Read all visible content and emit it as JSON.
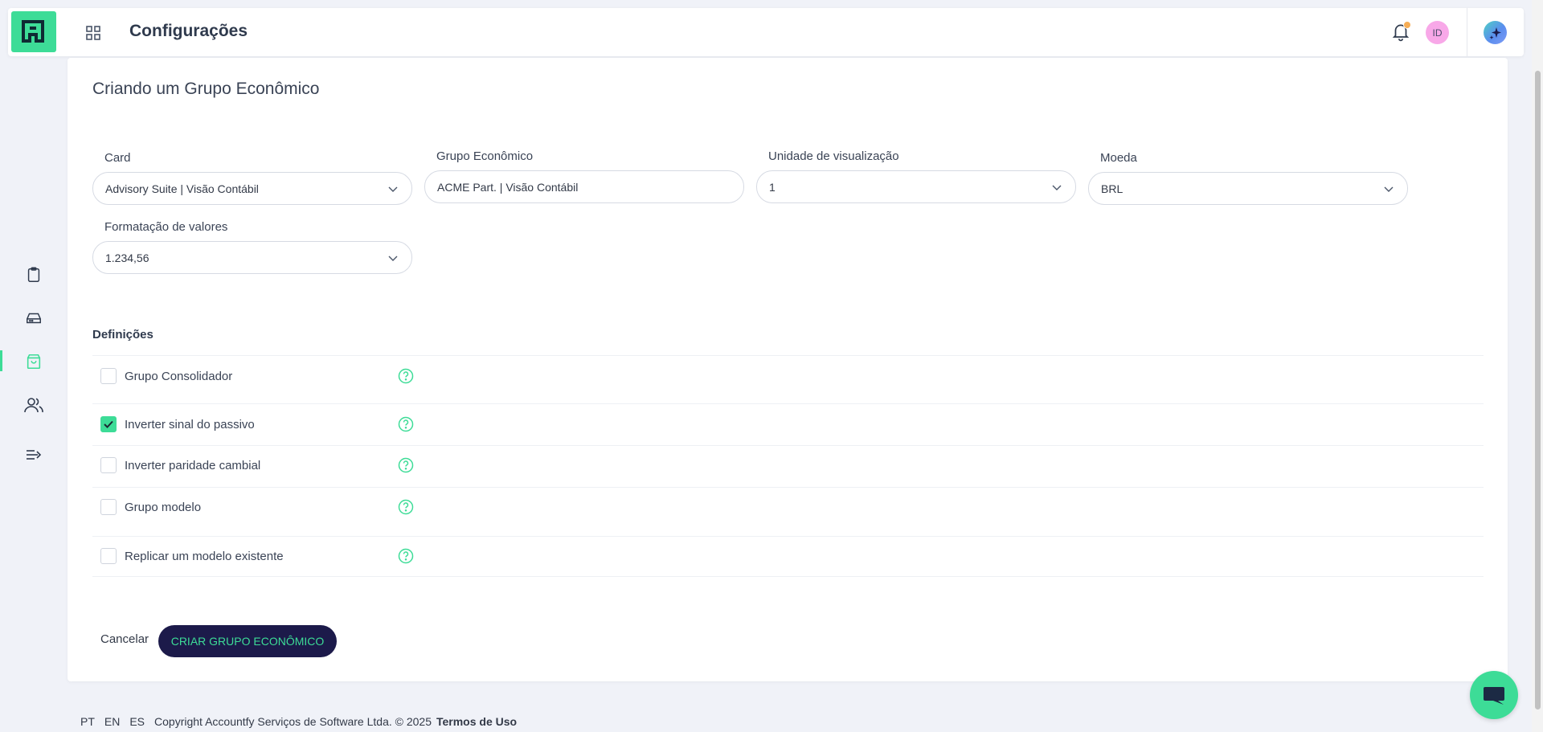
{
  "header": {
    "title": "Configurações",
    "avatar_initials": "ID",
    "icons": [
      "logo-icon",
      "apps-grid-icon",
      "bell-icon",
      "sparkle-icon"
    ]
  },
  "sidebar": {
    "items": [
      {
        "name": "clipboard-icon",
        "active": false
      },
      {
        "name": "inbox-icon",
        "active": false
      },
      {
        "name": "shopping-bag-icon",
        "active": true
      },
      {
        "name": "users-icon",
        "active": false
      },
      {
        "name": "collapse-menu-icon",
        "active": false
      }
    ]
  },
  "form": {
    "title": "Criando um Grupo Econômico",
    "card": {
      "label": "Card",
      "value": "Advisory Suite | Visão Contábil"
    },
    "grupo": {
      "label": "Grupo Econômico",
      "value": "ACME Part. | Visão Contábil"
    },
    "unidade": {
      "label": "Unidade de visualização",
      "value": "1"
    },
    "moeda": {
      "label": "Moeda",
      "value": "BRL"
    },
    "formatacao": {
      "label": "Formatação de valores",
      "value": "1.234,56"
    }
  },
  "definitions": {
    "title": "Definições",
    "items": [
      {
        "label": "Grupo Consolidador",
        "checked": false
      },
      {
        "label": "Inverter sinal do passivo",
        "checked": true
      },
      {
        "label": "Inverter paridade cambial",
        "checked": false
      },
      {
        "label": "Grupo modelo",
        "checked": false
      },
      {
        "label": "Replicar um modelo existente",
        "checked": false
      }
    ]
  },
  "actions": {
    "cancel": "Cancelar",
    "submit": "CRIAR GRUPO ECONÔMICO"
  },
  "footer": {
    "langs": [
      "PT",
      "EN",
      "ES"
    ],
    "copyright": "Copyright Accountfy Serviços de Software Ltda. © 2025",
    "terms": "Termos de Uso"
  },
  "colors": {
    "accent": "#3ddc97",
    "primary_button": "#1c1a4a",
    "background": "#f0f2f8"
  }
}
